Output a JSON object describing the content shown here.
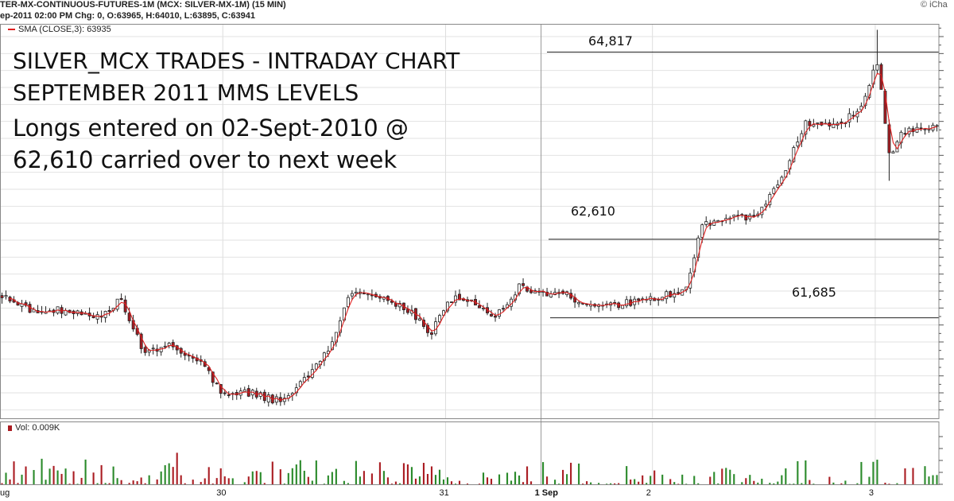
{
  "header": {
    "line1": "TER-MX-CONTINUOUS-FUTURES-1M (MCX: SILVER-MX-1M) (15 MIN)",
    "line2": "ep-2011 02:00 PM Chg: 0, O:63965, H:64010, L:63895, C:63941",
    "brand": "iCha"
  },
  "legend": {
    "sma": "SMA (CLOSE,3): 63935",
    "volume": "Vol: 0.009K"
  },
  "annotations": {
    "title_line1": "SILVER_MCX TRADES - INTRADAY CHART",
    "title_line2": "SEPTEMBER 2011 MMS LEVELS",
    "note_line1": "Longs entered on 02-Sept-2010 @",
    "note_line2": "62,610 carried over to next week"
  },
  "levels": [
    {
      "label": "64,817",
      "value": 64817
    },
    {
      "label": "62,610",
      "value": 62610
    },
    {
      "label": "61,685",
      "value": 61685
    }
  ],
  "chart_data": {
    "type": "candlestick",
    "interval": "15 MIN",
    "sessions": [
      {
        "label": "ug",
        "index": 0
      },
      {
        "label": "30",
        "index": 56
      },
      {
        "label": "31",
        "index": 112
      },
      {
        "label": "1 Sep",
        "index": 136
      },
      {
        "label": "2",
        "index": 164
      },
      {
        "label": "3",
        "index": 220
      }
    ],
    "price_keypoints": [
      [
        0,
        61950
      ],
      [
        8,
        61750
      ],
      [
        16,
        61780
      ],
      [
        24,
        61700
      ],
      [
        30,
        61900
      ],
      [
        36,
        61250
      ],
      [
        42,
        61400
      ],
      [
        50,
        61150
      ],
      [
        56,
        60750
      ],
      [
        62,
        60800
      ],
      [
        70,
        60700
      ],
      [
        76,
        60950
      ],
      [
        82,
        61300
      ],
      [
        88,
        62000
      ],
      [
        96,
        61950
      ],
      [
        104,
        61700
      ],
      [
        108,
        61500
      ],
      [
        112,
        61900
      ],
      [
        118,
        61900
      ],
      [
        124,
        61700
      ],
      [
        130,
        62050
      ],
      [
        136,
        61950
      ],
      [
        142,
        61950
      ],
      [
        148,
        61800
      ],
      [
        156,
        61850
      ],
      [
        164,
        61900
      ],
      [
        172,
        62050
      ],
      [
        176,
        62800
      ],
      [
        182,
        62850
      ],
      [
        190,
        62900
      ],
      [
        196,
        63300
      ],
      [
        202,
        64000
      ],
      [
        210,
        63950
      ],
      [
        216,
        64150
      ],
      [
        220,
        64700
      ],
      [
        223,
        63600
      ],
      [
        226,
        63850
      ],
      [
        234,
        63950
      ]
    ],
    "ylim": [
      60500,
      65150
    ],
    "volume_peak": 5,
    "volume_axis_ticks": [
      0,
      1,
      2,
      3,
      4
    ],
    "sma_period": 3,
    "up_color": "#ffffff",
    "down_color": "#aa1c22",
    "sma_color": "#e02020",
    "volume_up_color": "#2a8a2a",
    "volume_down_color": "#aa1c22"
  }
}
